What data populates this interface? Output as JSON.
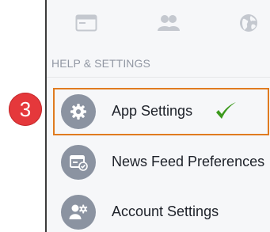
{
  "tabs": [
    {
      "icon": "newspaper-icon"
    },
    {
      "icon": "friends-icon"
    },
    {
      "icon": "globe-icon"
    }
  ],
  "section": {
    "header": "HELP & SETTINGS"
  },
  "menu": {
    "items": [
      {
        "label": "App Settings",
        "icon": "gear-icon"
      },
      {
        "label": "News Feed Preferences",
        "icon": "news-feed-preferences-icon"
      },
      {
        "label": "Account Settings",
        "icon": "account-settings-icon"
      }
    ]
  },
  "annotation": {
    "step_number": "3",
    "highlight_color": "#e07b20",
    "badge_color": "#e5383b",
    "check_color": "#3c9a1d",
    "check_icon": "checkmark-icon"
  }
}
